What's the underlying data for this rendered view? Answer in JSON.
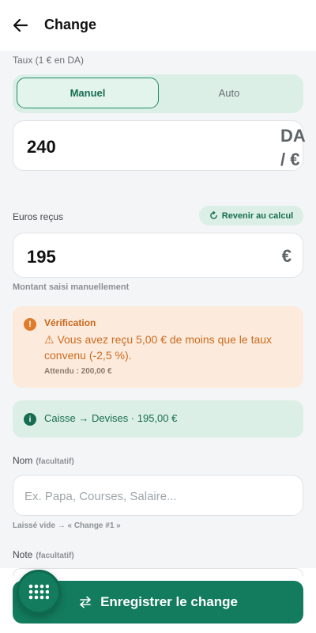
{
  "header": {
    "title": "Change",
    "back_icon": "arrow-left-icon"
  },
  "rate": {
    "label": "Taux (1 € en DA)",
    "modes": [
      "Manuel",
      "Auto"
    ],
    "selected_mode": "Manuel",
    "value": "240",
    "unit_line1": "DA",
    "unit_line2": "/ €"
  },
  "received": {
    "label": "Euros reçus",
    "revert_label": "Revenir au calcul",
    "value": "195",
    "unit": "€",
    "hint": "Montant saisi manuellement"
  },
  "warning": {
    "title": "Vérification",
    "message": "⚠ Vous avez reçu 5,00 € de moins que le taux convenu (-2,5 %).",
    "expected": "Attendu : 200,00 €",
    "color": "#e07b2a"
  },
  "info": {
    "text": "Caisse → Devises · 195,00 €",
    "color": "#176d52"
  },
  "nom": {
    "label": "Nom",
    "optional": "(facultatif)",
    "value": "",
    "placeholder": "Ex. Papa, Courses, Salaire...",
    "hint": "Laissé vide → « Change #1 »"
  },
  "note": {
    "label": "Note",
    "optional": "(facultatif)"
  },
  "save_button": {
    "label": "Enregistrer le change",
    "color": "#137c5e"
  },
  "fab": {
    "icon": "grid-dots-icon"
  }
}
